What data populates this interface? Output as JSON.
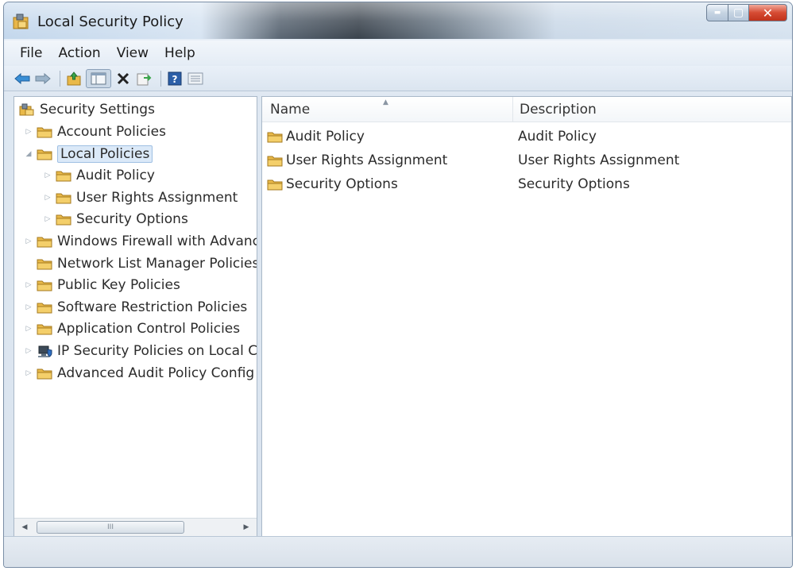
{
  "window": {
    "title": "Local Security Policy",
    "controls": {
      "minimize": "▬",
      "maximize": "▢",
      "close": "✕"
    }
  },
  "menubar": {
    "items": [
      {
        "label": "File"
      },
      {
        "label": "Action"
      },
      {
        "label": "View"
      },
      {
        "label": "Help"
      }
    ]
  },
  "toolbar": {
    "buttons": [
      "back-arrow-icon",
      "forward-arrow-icon",
      "up-folder-icon",
      "show-hide-console-tree-icon",
      "delete-icon",
      "export-list-icon",
      "help-icon",
      "properties-icon"
    ]
  },
  "tree": {
    "root": {
      "label": "Security Settings"
    },
    "items": [
      {
        "label": "Account Policies",
        "level": 1,
        "expander": "▷",
        "icon": "folder-icon"
      },
      {
        "label": "Local Policies",
        "level": 1,
        "expander": "◢",
        "icon": "folder-icon",
        "selected": true
      },
      {
        "label": "Audit Policy",
        "level": 2,
        "expander": "▷",
        "icon": "folder-icon"
      },
      {
        "label": "User Rights Assignment",
        "level": 2,
        "expander": "▷",
        "icon": "folder-icon"
      },
      {
        "label": "Security Options",
        "level": 2,
        "expander": "▷",
        "icon": "folder-icon"
      },
      {
        "label": "Windows Firewall with Advanc",
        "level": 1,
        "expander": "▷",
        "icon": "folder-icon"
      },
      {
        "label": "Network List Manager Policies",
        "level": 1,
        "expander": "",
        "icon": "folder-icon"
      },
      {
        "label": "Public Key Policies",
        "level": 1,
        "expander": "▷",
        "icon": "folder-icon"
      },
      {
        "label": "Software Restriction Policies",
        "level": 1,
        "expander": "▷",
        "icon": "folder-icon"
      },
      {
        "label": "Application Control Policies",
        "level": 1,
        "expander": "▷",
        "icon": "folder-icon"
      },
      {
        "label": "IP Security Policies on Local Co",
        "level": 1,
        "expander": "▷",
        "icon": "computer-shield-icon"
      },
      {
        "label": "Advanced Audit Policy Config",
        "level": 1,
        "expander": "▷",
        "icon": "folder-icon"
      }
    ],
    "scrollbar": {
      "thumb_grip": "III",
      "left": "◀",
      "right": "▶"
    }
  },
  "list": {
    "columns": {
      "name": "Name",
      "description": "Description",
      "sort_indicator": "▲"
    },
    "rows": [
      {
        "name": "Audit Policy",
        "description": "Audit Policy"
      },
      {
        "name": "User Rights Assignment",
        "description": "User Rights Assignment"
      },
      {
        "name": "Security Options",
        "description": "Security Options"
      }
    ]
  },
  "colors": {
    "selection": "#dbe9f8",
    "folder": "#e9b949",
    "close_button": "#c8381f"
  }
}
